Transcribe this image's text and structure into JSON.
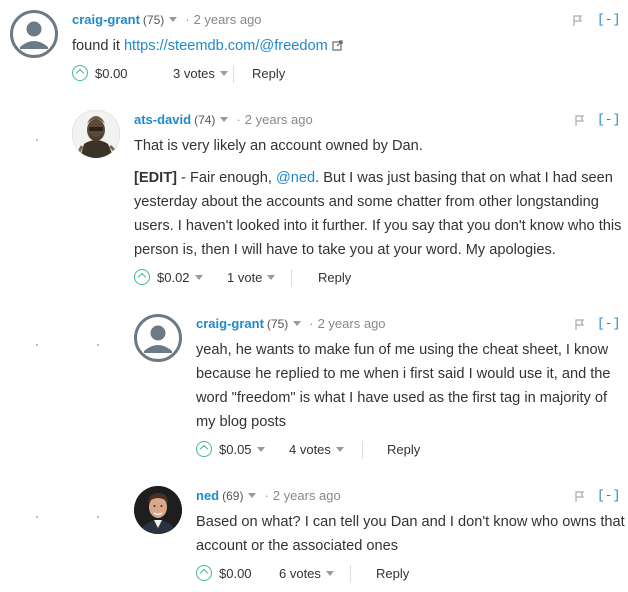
{
  "comments": [
    {
      "author": "craig-grant",
      "rep": "(75)",
      "time": "2 years ago",
      "collapse": "[-]",
      "text_prefix": "found it ",
      "link": "https://steemdb.com/@freedom",
      "payout": "$0.00",
      "votes": "3 votes",
      "reply": "Reply",
      "avatar": "user-placeholder-icon"
    },
    {
      "author": "ats-david",
      "rep": "(74)",
      "time": "2 years ago",
      "collapse": "[-]",
      "para1": "That is very likely an account owned by Dan.",
      "edit_tag": "[EDIT]",
      "para2_a": " - Fair enough, ",
      "mention": "@ned",
      "para2_b": ". But I was just basing that on what I had seen yesterday about the accounts and some chatter from other longstanding users. I haven't looked into it further. If you say that you don't know who this person is, then I will have to take you at your word. My apologies.",
      "payout": "$0.02",
      "votes": "1 vote",
      "reply": "Reply",
      "avatar": "masked-figure-avatar"
    },
    {
      "author": "craig-grant",
      "rep": "(75)",
      "time": "2 years ago",
      "collapse": "[-]",
      "para1": "yeah, he wants to make fun of me using the cheat sheet, I know because he replied to me when i first said I would use it, and the word \"freedom\" is what I have used as the first tag in majority of my blog posts",
      "payout": "$0.05",
      "votes": "4 votes",
      "reply": "Reply",
      "avatar": "user-placeholder-icon"
    },
    {
      "author": "ned",
      "rep": "(69)",
      "time": "2 years ago",
      "collapse": "[-]",
      "para1": "Based on what? I can tell you Dan and I don't know who owns that account or the associated ones",
      "payout": "$0.00",
      "votes": "6 votes",
      "reply": "Reply",
      "avatar": "man-portrait-avatar"
    }
  ],
  "colors": {
    "link": "#1f8acb",
    "upvote": "#44bb88",
    "text": "#333333",
    "muted": "#888888"
  }
}
